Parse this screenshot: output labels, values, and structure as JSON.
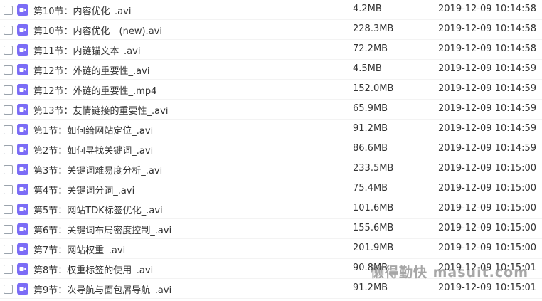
{
  "colors": {
    "video_icon": "#7b6cf6",
    "text": "#333333"
  },
  "icon": "video-file-icon",
  "files": [
    {
      "name": "第10节：内容优化_.avi",
      "size": "4.2MB",
      "modified": "2019-12-09 10:14:58"
    },
    {
      "name": "第10节：内容优化__(new).avi",
      "size": "228.3MB",
      "modified": "2019-12-09 10:14:58"
    },
    {
      "name": "第11节：内链锚文本_.avi",
      "size": "72.2MB",
      "modified": "2019-12-09 10:14:58"
    },
    {
      "name": "第12节：外链的重要性_.avi",
      "size": "4.5MB",
      "modified": "2019-12-09 10:14:59"
    },
    {
      "name": "第12节：外链的重要性_.mp4",
      "size": "152.0MB",
      "modified": "2019-12-09 10:14:59"
    },
    {
      "name": "第13节：友情链接的重要性_.avi",
      "size": "65.9MB",
      "modified": "2019-12-09 10:14:59"
    },
    {
      "name": "第1节：如何给网站定位_.avi",
      "size": "91.2MB",
      "modified": "2019-12-09 10:14:59"
    },
    {
      "name": "第2节：如何寻找关键词_.avi",
      "size": "86.6MB",
      "modified": "2019-12-09 10:14:59"
    },
    {
      "name": "第3节：关键词难易度分析_.avi",
      "size": "233.5MB",
      "modified": "2019-12-09 10:15:00"
    },
    {
      "name": "第4节：关键词分词_.avi",
      "size": "75.4MB",
      "modified": "2019-12-09 10:15:00"
    },
    {
      "name": "第5节：网站TDK标签优化_.avi",
      "size": "101.6MB",
      "modified": "2019-12-09 10:15:00"
    },
    {
      "name": "第6节：关键词布局密度控制_.avi",
      "size": "155.6MB",
      "modified": "2019-12-09 10:15:00"
    },
    {
      "name": "第7节：网站权重_.avi",
      "size": "201.9MB",
      "modified": "2019-12-09 10:15:00"
    },
    {
      "name": "第8节：权重标签的使用_.avi",
      "size": "90.8MB",
      "modified": "2019-12-09 10:15:01"
    },
    {
      "name": "第9节：次导航与面包屑导航_.avi",
      "size": "91.2MB",
      "modified": "2019-12-09 10:15:01"
    }
  ],
  "watermark": "懒得勤快 masuit.com"
}
